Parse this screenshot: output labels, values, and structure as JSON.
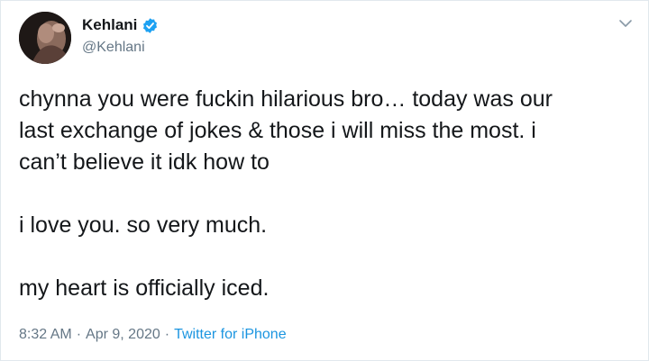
{
  "author": {
    "display_name": "Kehlani",
    "handle": "@Kehlani",
    "verified_icon": "verified-badge-icon",
    "avatar_icon": "avatar-photo"
  },
  "tweet": {
    "line1": "chynna you were fuckin hilarious bro… today was our",
    "line2": "last exchange of jokes & those i will miss the most. i",
    "line3": "can’t believe it idk how to",
    "line4": "i love you. so very much.",
    "line5": "my heart is officially iced."
  },
  "meta": {
    "time": "8:32 AM",
    "separator": "·",
    "date": "Apr 9, 2020",
    "source": "Twitter for iPhone"
  },
  "menu_icon": "chevron-down-icon",
  "colors": {
    "text": "#14171a",
    "secondary": "#657786",
    "link": "#1b95e0",
    "verified": "#1da1f2",
    "border": "#e1e8ed"
  }
}
